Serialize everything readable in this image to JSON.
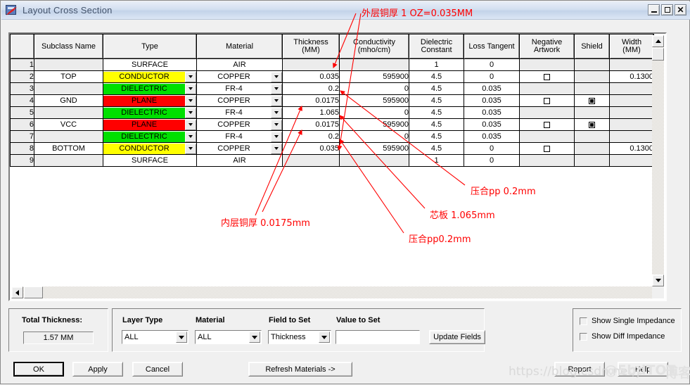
{
  "window": {
    "title": "Layout Cross Section",
    "icon": "layout-cross-section-icon",
    "minimize": "_",
    "maximize": "□",
    "close": "✕"
  },
  "grid": {
    "columns": [
      {
        "key": "rownum",
        "label": ""
      },
      {
        "key": "subclass",
        "label": "Subclass Name"
      },
      {
        "key": "type",
        "label": "Type"
      },
      {
        "key": "material",
        "label": "Material"
      },
      {
        "key": "thickness",
        "label": "Thickness",
        "label2": "(MM)"
      },
      {
        "key": "conductivity",
        "label": "Conductivity",
        "label2": "(mho/cm)"
      },
      {
        "key": "dielectric",
        "label": "Dielectric",
        "label2": "Constant"
      },
      {
        "key": "loss",
        "label": "Loss Tangent"
      },
      {
        "key": "negative",
        "label": "Negative",
        "label2": "Artwork"
      },
      {
        "key": "shield",
        "label": "Shield"
      },
      {
        "key": "width",
        "label": "Width",
        "label2": "(MM)"
      }
    ],
    "rows": [
      {
        "n": "1",
        "subclass": "",
        "type": "SURFACE",
        "typeColor": "none",
        "typeCombo": false,
        "material": "AIR",
        "materialCombo": false,
        "thickness": "",
        "conductivity": "",
        "dielectric": "1",
        "loss": "0",
        "negative": "",
        "shield": "",
        "width": ""
      },
      {
        "n": "2",
        "subclass": "TOP",
        "type": "CONDUCTOR",
        "typeColor": "conductor",
        "typeCombo": true,
        "material": "COPPER",
        "materialCombo": true,
        "thickness": "0.035",
        "conductivity": "595900",
        "dielectric": "4.5",
        "loss": "0",
        "negative": "checkbox",
        "shield": "",
        "width": "0.1300"
      },
      {
        "n": "3",
        "subclass": "",
        "type": "DIELECTRIC",
        "typeColor": "dielectric",
        "typeCombo": true,
        "material": "FR-4",
        "materialCombo": true,
        "thickness": "0.2",
        "conductivity": "0",
        "dielectric": "4.5",
        "loss": "0.035",
        "negative": "",
        "shield": "",
        "width": ""
      },
      {
        "n": "4",
        "subclass": "GND",
        "type": "PLANE",
        "typeColor": "plane",
        "typeCombo": true,
        "material": "COPPER",
        "materialCombo": true,
        "thickness": "0.0175",
        "conductivity": "595900",
        "dielectric": "4.5",
        "loss": "0.035",
        "negative": "checkbox",
        "shield": "checkbox-checked",
        "width": ""
      },
      {
        "n": "5",
        "subclass": "",
        "type": "DIELECTRIC",
        "typeColor": "dielectric",
        "typeCombo": true,
        "material": "FR-4",
        "materialCombo": true,
        "thickness": "1.065",
        "conductivity": "0",
        "dielectric": "4.5",
        "loss": "0.035",
        "negative": "",
        "shield": "",
        "width": ""
      },
      {
        "n": "6",
        "subclass": "VCC",
        "type": "PLANE",
        "typeColor": "plane",
        "typeCombo": true,
        "material": "COPPER",
        "materialCombo": true,
        "thickness": "0.0175",
        "conductivity": "595900",
        "dielectric": "4.5",
        "loss": "0.035",
        "negative": "checkbox",
        "shield": "checkbox-checked",
        "width": ""
      },
      {
        "n": "7",
        "subclass": "",
        "type": "DIELECTRIC",
        "typeColor": "dielectric",
        "typeCombo": true,
        "material": "FR-4",
        "materialCombo": true,
        "thickness": "0.2",
        "conductivity": "0",
        "dielectric": "4.5",
        "loss": "0.035",
        "negative": "",
        "shield": "",
        "width": ""
      },
      {
        "n": "8",
        "subclass": "BOTTOM",
        "type": "CONDUCTOR",
        "typeColor": "conductor",
        "typeCombo": true,
        "material": "COPPER",
        "materialCombo": true,
        "thickness": "0.035",
        "conductivity": "595900",
        "dielectric": "4.5",
        "loss": "0",
        "negative": "checkbox",
        "shield": "",
        "width": "0.1300"
      },
      {
        "n": "9",
        "subclass": "",
        "type": "SURFACE",
        "typeColor": "none",
        "typeCombo": false,
        "material": "AIR",
        "materialCombo": false,
        "thickness": "",
        "conductivity": "",
        "dielectric": "1",
        "loss": "0",
        "negative": "",
        "shield": "",
        "width": ""
      }
    ]
  },
  "total": {
    "label": "Total Thickness:",
    "value": "1.57 MM"
  },
  "setpanel": {
    "layer_type_label": "Layer Type",
    "layer_type_value": "ALL",
    "material_label": "Material",
    "material_value": "ALL",
    "field_to_set_label": "Field to Set",
    "field_to_set_value": "Thickness",
    "value_to_set_label": "Value to Set",
    "value_to_set_value": "",
    "update_fields": "Update Fields"
  },
  "impedance": {
    "show_single": "Show Single Impedance",
    "show_diff": "Show Diff Impedance"
  },
  "buttons": {
    "ok": "OK",
    "apply": "Apply",
    "cancel": "Cancel",
    "refresh": "Refresh Materials ->",
    "report": "Report",
    "help": "Help"
  },
  "annotations": [
    {
      "id": "outer-copper",
      "text": "外层铜厚 1 OZ=0.035MM"
    },
    {
      "id": "inner-copper",
      "text": "内层铜厚 0.0175mm"
    },
    {
      "id": "prepreg-bottom",
      "text": "压合pp0.2mm"
    },
    {
      "id": "core",
      "text": "芯板 1.065mm"
    },
    {
      "id": "prepreg-top",
      "text": "压合pp 0.2mm"
    }
  ],
  "watermark": {
    "url": "https://blog.csdn.net/j",
    "handle": "@5bdTOT",
    "suffix": "博客"
  }
}
